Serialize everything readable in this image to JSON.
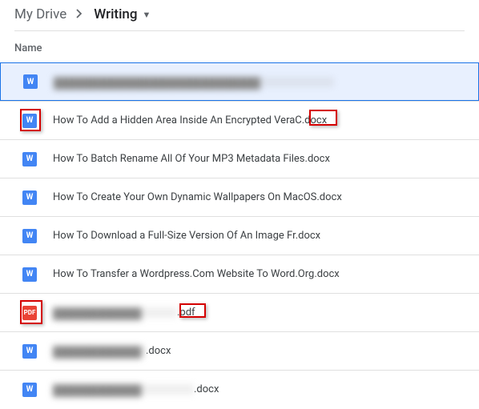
{
  "breadcrumb": {
    "root": "My Drive",
    "current": "Writing"
  },
  "columns": {
    "name": "Name"
  },
  "icons": {
    "word": "W",
    "pdf": "PDF"
  },
  "files": [
    {
      "type": "word",
      "selected": true,
      "redacted": true,
      "blur_width": 350,
      "name": "",
      "ext": ""
    },
    {
      "type": "word",
      "highlight_icon": true,
      "highlight_ext": true,
      "name": "How To Add a Hidden Area Inside An Encrypted VeraC",
      "ext": ".docx"
    },
    {
      "type": "word",
      "name": "How To Batch Rename All Of Your MP3 Metadata Files.docx",
      "ext": ""
    },
    {
      "type": "word",
      "name": "How To Create Your Own Dynamic Wallpapers On MacOS.docx",
      "ext": ""
    },
    {
      "type": "word",
      "name": "How To Download a Full-Size Version Of An Image Fr.docx",
      "ext": ""
    },
    {
      "type": "word",
      "name": "How To Transfer a Wordpress.Com Website To Word.Org.docx",
      "ext": ""
    },
    {
      "type": "pdf",
      "highlight_icon": true,
      "highlight_ext": true,
      "redacted_name": true,
      "blur_width_name": 155,
      "name": "",
      "ext": ".pdf"
    },
    {
      "type": "word",
      "redacted_name": true,
      "blur_width_name": 116,
      "name": "",
      "ext": ".docx"
    },
    {
      "type": "word",
      "redacted_name": true,
      "blur_width_name": 176,
      "name": "",
      "ext": ".docx"
    }
  ]
}
